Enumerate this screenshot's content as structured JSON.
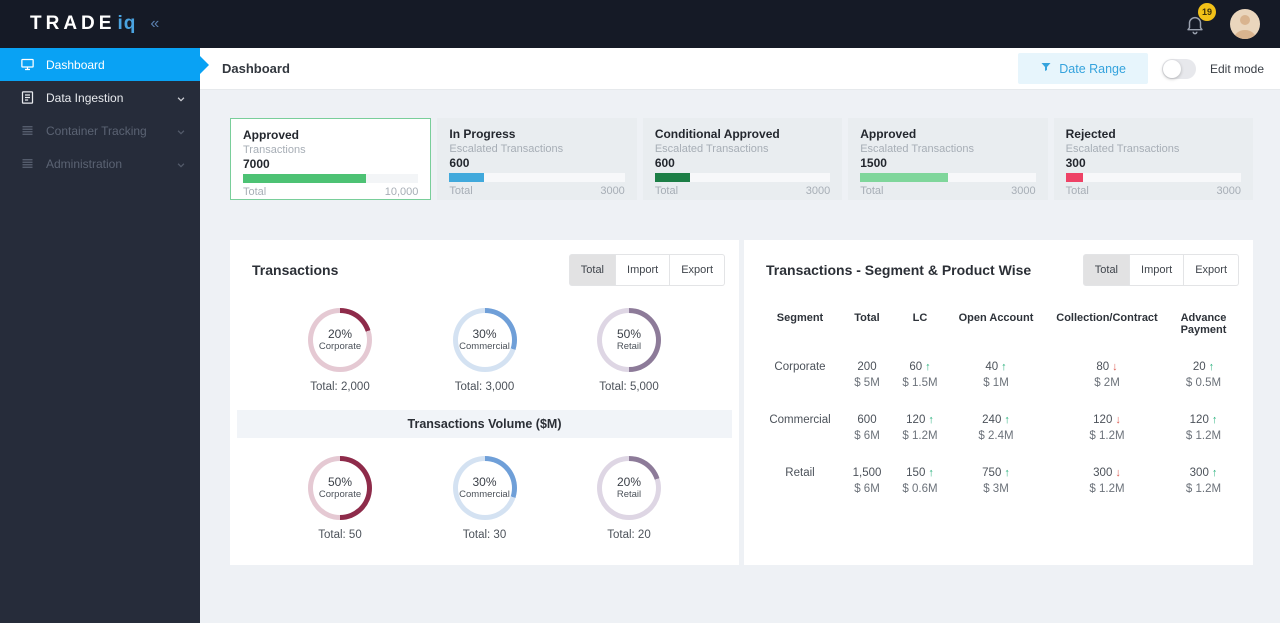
{
  "brand": {
    "name": "TRADE",
    "suffix": "iq",
    "collapse_icon": "«"
  },
  "topbar": {
    "notification_count": "19"
  },
  "sidebar": {
    "items": [
      {
        "label": "Dashboard",
        "icon": "dashboard-monitor-icon",
        "active": true
      },
      {
        "label": "Data Ingestion",
        "icon": "data-ingestion-document-icon",
        "expandable": true
      },
      {
        "label": "Container Tracking",
        "icon": "container-tracking-list-icon",
        "expandable": true,
        "disabled": true
      },
      {
        "label": "Administration",
        "icon": "administration-list-icon",
        "expandable": true,
        "disabled": true
      }
    ]
  },
  "header": {
    "title": "Dashboard",
    "date_range_label": "Date Range",
    "edit_mode_label": "Edit mode",
    "accent_color": "#35a3dd"
  },
  "cards": [
    {
      "title": "Approved",
      "subtitle": "Transactions",
      "value": "7000",
      "total_label": "Total",
      "total": "10,000",
      "progress": "70%",
      "bar_color": "#4dc274",
      "selected": true
    },
    {
      "title": "In Progress",
      "subtitle": "Escalated Transactions",
      "value": "600",
      "total_label": "Total",
      "total": "3000",
      "progress": "20%",
      "bar_color": "#41a9dc"
    },
    {
      "title": "Conditional Approved",
      "subtitle": "Escalated Transactions",
      "value": "600",
      "total_label": "Total",
      "total": "3000",
      "progress": "20%",
      "bar_color": "#1c7e46"
    },
    {
      "title": "Approved",
      "subtitle": "Escalated Transactions",
      "value": "1500",
      "total_label": "Total",
      "total": "3000",
      "progress": "50%",
      "bar_color": "#7fd69b"
    },
    {
      "title": "Rejected",
      "subtitle": "Escalated Transactions",
      "value": "300",
      "total_label": "Total",
      "total": "3000",
      "progress": "10%",
      "bar_color": "#ee4266"
    }
  ],
  "left_panel": {
    "title": "Transactions",
    "tabs": [
      {
        "label": "Total",
        "active": true
      },
      {
        "label": "Import"
      },
      {
        "label": "Export"
      }
    ],
    "count_donuts": [
      {
        "pct": "20%",
        "label": "Corporate",
        "total": "Total: 2,000",
        "arc_color": "#8e2b4a",
        "track_color": "#e5c9d3"
      },
      {
        "pct": "30%",
        "label": "Commercial",
        "total": "Total: 3,000",
        "arc_color": "#6f9fd8",
        "track_color": "#d4e2f2"
      },
      {
        "pct": "50%",
        "label": "Retail",
        "total": "Total: 5,000",
        "arc_color": "#8d7b99",
        "track_color": "#ded6e4"
      }
    ],
    "volume_title": "Transactions Volume ($M)",
    "volume_donuts": [
      {
        "pct": "50%",
        "label": "Corporate",
        "total": "Total: 50",
        "arc_color": "#8e2b4a",
        "track_color": "#e5c9d3"
      },
      {
        "pct": "30%",
        "label": "Commercial",
        "total": "Total: 30",
        "arc_color": "#6f9fd8",
        "track_color": "#d4e2f2"
      },
      {
        "pct": "20%",
        "label": "Retail",
        "total": "Total: 20",
        "arc_color": "#8d7b99",
        "track_color": "#ded6e4"
      }
    ]
  },
  "right_panel": {
    "title": "Transactions - Segment & Product Wise",
    "tabs": [
      {
        "label": "Total",
        "active": true
      },
      {
        "label": "Import"
      },
      {
        "label": "Export"
      }
    ],
    "table": {
      "headers": [
        "Segment",
        "Total",
        "LC",
        "Open Account",
        "Collection/Contract",
        "Advance Payment"
      ],
      "trend_up_color": "#2fb380",
      "trend_down_color": "#dd6057",
      "rows": [
        {
          "segment": "Corporate",
          "cells": [
            {
              "value": "200",
              "trend": "",
              "trend_color": "",
              "amount": "$ 5M"
            },
            {
              "value": "60",
              "trend": "↑",
              "trend_color": "#2fb380",
              "amount": "$ 1.5M"
            },
            {
              "value": "40",
              "trend": "↑",
              "trend_color": "#2fb380",
              "amount": "$ 1M"
            },
            {
              "value": "80",
              "trend": "↓",
              "trend_color": "#dd6057",
              "amount": "$ 2M"
            },
            {
              "value": "20",
              "trend": "↑",
              "trend_color": "#2fb380",
              "amount": "$ 0.5M"
            }
          ]
        },
        {
          "segment": "Commercial",
          "cells": [
            {
              "value": "600",
              "trend": "",
              "trend_color": "",
              "amount": "$ 6M"
            },
            {
              "value": "120",
              "trend": "↑",
              "trend_color": "#2fb380",
              "amount": "$ 1.2M"
            },
            {
              "value": "240",
              "trend": "↑",
              "trend_color": "#2fb380",
              "amount": "$ 2.4M"
            },
            {
              "value": "120",
              "trend": "↓",
              "trend_color": "#dd6057",
              "amount": "$ 1.2M"
            },
            {
              "value": "120",
              "trend": "↑",
              "trend_color": "#2fb380",
              "amount": "$ 1.2M"
            }
          ]
        },
        {
          "segment": "Retail",
          "cells": [
            {
              "value": "1,500",
              "trend": "",
              "trend_color": "",
              "amount": "$ 6M"
            },
            {
              "value": "150",
              "trend": "↑",
              "trend_color": "#2fb380",
              "amount": "$ 0.6M"
            },
            {
              "value": "750",
              "trend": "↑",
              "trend_color": "#2fb380",
              "amount": "$ 3M"
            },
            {
              "value": "300",
              "trend": "↓",
              "trend_color": "#dd6057",
              "amount": "$ 1.2M"
            },
            {
              "value": "300",
              "trend": "↑",
              "trend_color": "#2fb380",
              "amount": "$ 1.2M"
            }
          ]
        }
      ]
    }
  }
}
